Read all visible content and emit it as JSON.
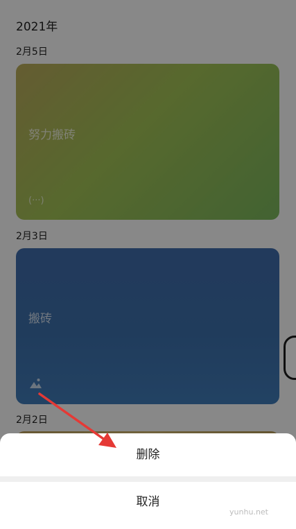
{
  "header": {
    "year_label": "2021年"
  },
  "entries": [
    {
      "date": "2月5日",
      "title": "努力搬砖",
      "meta": "(···)"
    },
    {
      "date": "2月3日",
      "title": "搬砖",
      "meta_icon": "mountain-photo-icon"
    },
    {
      "date": "2月2日"
    }
  ],
  "action_sheet": {
    "delete_label": "删除",
    "cancel_label": "取消"
  },
  "watermark": "yunhu.net",
  "colors": {
    "annotation_arrow": "#e53935",
    "overlay": "#000000"
  }
}
